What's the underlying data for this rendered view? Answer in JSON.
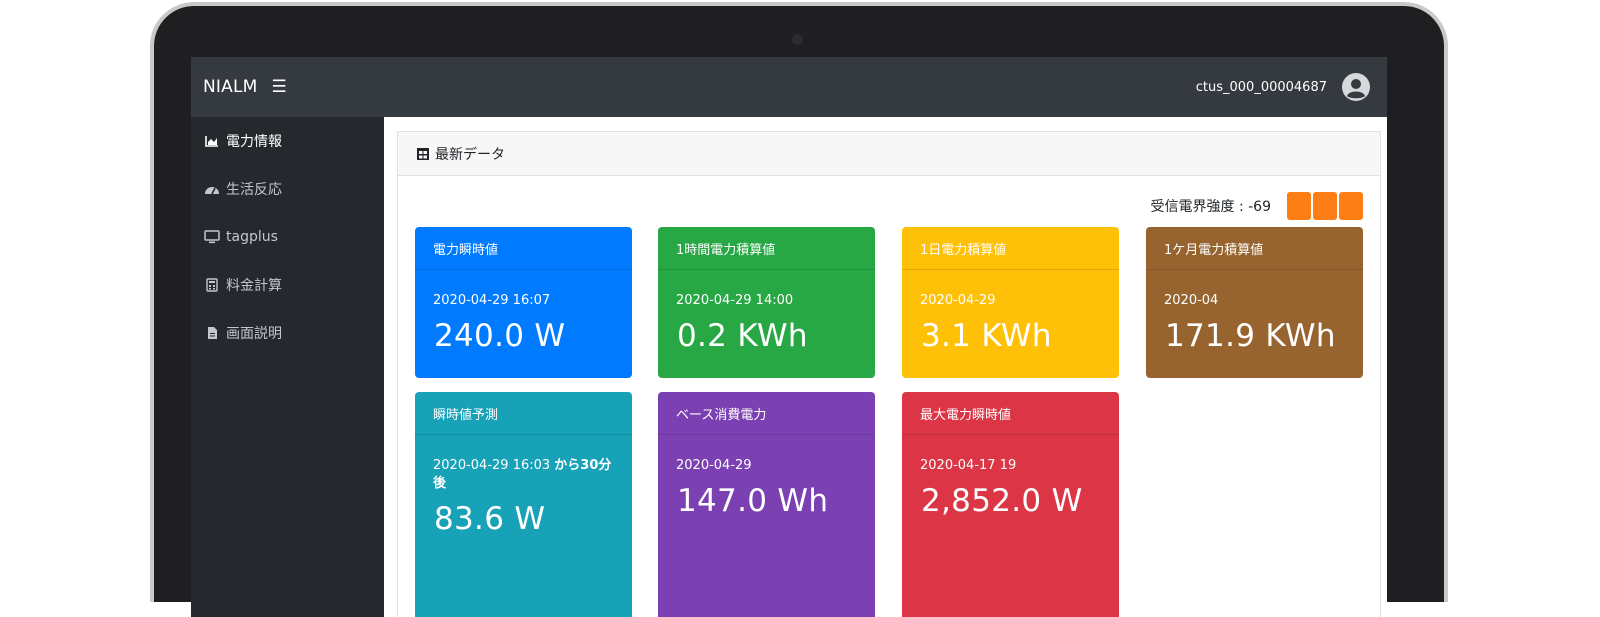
{
  "navbar": {
    "brand": "NIALM",
    "menu_icon": "hamburger-icon",
    "username": "ctus_000_00004687",
    "avatar_icon": "user-circle-icon"
  },
  "sidebar": {
    "items": [
      {
        "label": "電力情報",
        "icon": "area-chart-icon",
        "active": true
      },
      {
        "label": "生活反応",
        "icon": "gauge-icon",
        "active": false
      },
      {
        "label": "tagplus",
        "icon": "monitor-icon",
        "active": false
      },
      {
        "label": "料金計算",
        "icon": "calculator-icon",
        "active": false
      },
      {
        "label": "画面説明",
        "icon": "document-icon",
        "active": false
      }
    ]
  },
  "card": {
    "title": "最新データ",
    "title_icon": "table-icon"
  },
  "signal": {
    "label": "受信電界強度 : -69",
    "color": "#fd7e14"
  },
  "tiles": [
    {
      "title": "電力瞬時値",
      "date": "2020-04-29 16:07",
      "value": "240.0 W",
      "color": "#007bff"
    },
    {
      "title": "1時間電力積算値",
      "date": "2020-04-29 14:00",
      "value": "0.2 KWh",
      "color": "#28a745"
    },
    {
      "title": "1日電力積算値",
      "date": "2020-04-29",
      "value": "3.1 KWh",
      "color": "#ffc107"
    },
    {
      "title": "1ケ月電力積算値",
      "date": "2020-04",
      "value": "171.9 KWh",
      "color": "#976430"
    },
    {
      "title": "瞬時値予測",
      "date": "2020-04-29 16:03",
      "date_suffix": "から30分後",
      "value": "83.6 W",
      "color": "#17a2b8"
    },
    {
      "title": "ベース消費電力",
      "date": "2020-04-29",
      "value": "147.0 Wh",
      "color": "#7b41b3"
    },
    {
      "title": "最大電力瞬時値",
      "date": "2020-04-17 19",
      "value": "2,852.0 W",
      "color": "#dc3545"
    }
  ]
}
